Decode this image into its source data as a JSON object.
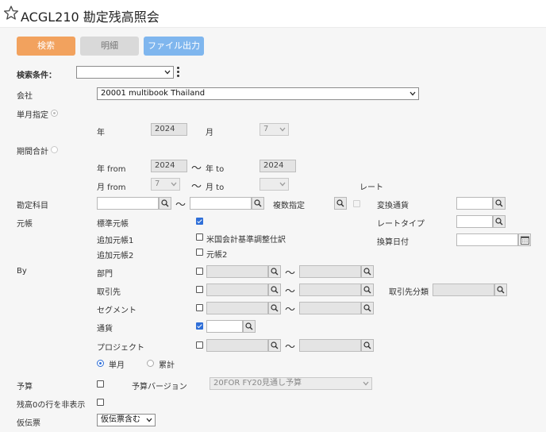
{
  "header": {
    "title": "ACGL210 勘定残高照会",
    "favorite_icon": "star-outline-icon"
  },
  "toolbar": {
    "search": "検索",
    "detail": "明細",
    "file_output": "ファイル出力"
  },
  "colors": {
    "search_button": "#f2a25e",
    "detail_button": "#d9d9d9",
    "file_button": "#7fb6ee",
    "check_accent": "#2f6fd8"
  },
  "search_condition": {
    "label": "検索条件：",
    "value": ""
  },
  "company": {
    "label": "会社",
    "value": "20001 multibook Thailand"
  },
  "single_month": {
    "label": "単月指定",
    "year_label": "年",
    "year_value": "2024",
    "month_label": "月",
    "month_value": "7"
  },
  "period_total": {
    "label": "期間合計",
    "year_from_label": "年 from",
    "year_from_value": "2024",
    "year_to_label": "年 to",
    "year_to_value": "2024",
    "month_from_label": "月 from",
    "month_from_value": "7",
    "month_to_label": "月 to",
    "month_to_value": ""
  },
  "rate": {
    "label": "レート",
    "conversion_currency_label": "変換通貨",
    "rate_type_label": "レートタイプ",
    "conversion_date_label": "換算日付"
  },
  "account": {
    "label": "勘定科目",
    "multi_label": "複数指定"
  },
  "ledger": {
    "label": "元帳",
    "standard_label": "標準元帳",
    "standard_checked": true,
    "additional1_label": "追加元帳1",
    "additional1_option": "米国会計基準調整仕訳",
    "additional2_label": "追加元帳2",
    "additional2_option": "元帳2"
  },
  "by": {
    "label": "By",
    "department": "部門",
    "customer": "取引先",
    "customer_category": "取引先分類",
    "segment": "セグメント",
    "currency": "通貨",
    "currency_checked": true,
    "project": "プロジェクト",
    "tilde": "〜"
  },
  "period_mode": {
    "monthly": "単月",
    "cumulative": "累計",
    "selected": "monthly"
  },
  "budget": {
    "label": "予算",
    "version_label": "予算バージョン",
    "version_value": "20FOR FY20見通し予算"
  },
  "hide_zero": {
    "label": "残高0の行を非表示"
  },
  "voucher": {
    "label": "仮伝票",
    "value": "仮伝票含む"
  }
}
